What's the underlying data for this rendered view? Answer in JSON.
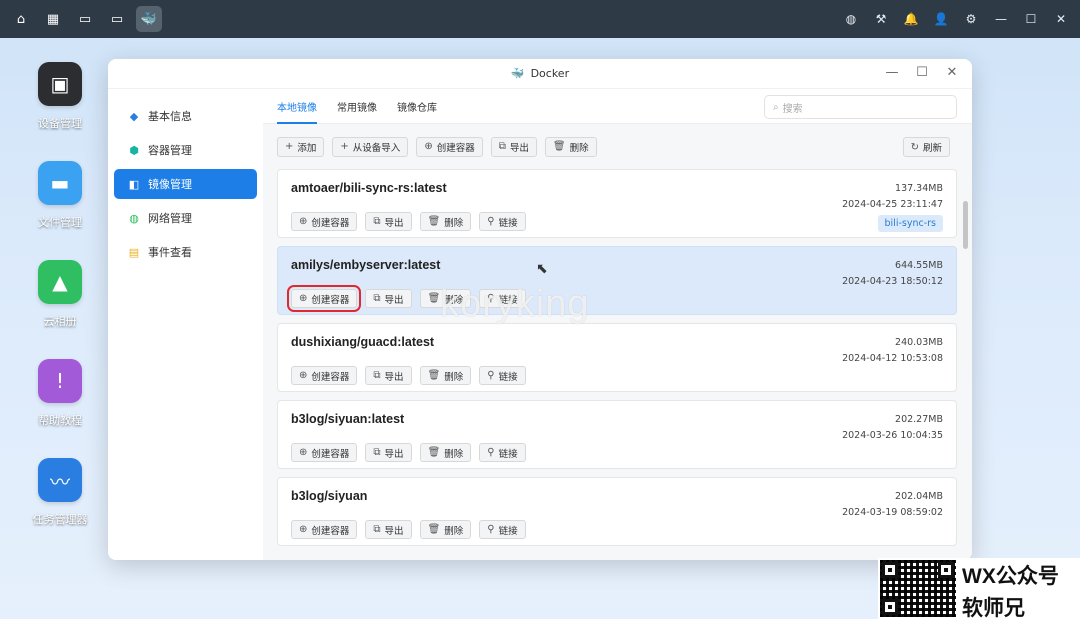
{
  "taskbar": {
    "left_icons": [
      "home-icon",
      "apps-grid-icon",
      "window-icon",
      "window-icon",
      "docker-icon"
    ],
    "right_icons": [
      "globe-icon",
      "tools-icon",
      "bell-icon",
      "user-icon",
      "settings-icon",
      "minimize-icon",
      "maximize-icon",
      "close-icon"
    ]
  },
  "desktop": {
    "items": [
      {
        "label": "设备管理",
        "icon": "device-icon",
        "color": "#2b2d31"
      },
      {
        "label": "文件管理",
        "icon": "folder-icon",
        "color": "#3aa2f0"
      },
      {
        "label": "云相册",
        "icon": "photo-icon",
        "color": "#2fbf62"
      },
      {
        "label": "帮助教程",
        "icon": "help-icon",
        "color": "#a25ad8"
      },
      {
        "label": "任务管理器",
        "icon": "monitor-icon",
        "color": "#2a7de1"
      }
    ]
  },
  "window": {
    "title": "Docker",
    "sidebar": [
      {
        "label": "基本信息",
        "icon": "docker-icon",
        "active": false
      },
      {
        "label": "容器管理",
        "icon": "cube-icon",
        "active": false
      },
      {
        "label": "镜像管理",
        "icon": "image-icon",
        "active": true
      },
      {
        "label": "网络管理",
        "icon": "globe-icon",
        "active": false
      },
      {
        "label": "事件查看",
        "icon": "event-icon",
        "active": false
      }
    ],
    "tabs": [
      "本地镜像",
      "常用镜像",
      "镜像仓库"
    ],
    "search_placeholder": "搜索",
    "toolbar": {
      "add": "添加",
      "import": "从设备导入",
      "create": "创建容器",
      "export": "导出",
      "delete": "删除",
      "refresh": "刷新"
    },
    "card_actions": {
      "create": "创建容器",
      "export": "导出",
      "delete": "删除",
      "link": "链接"
    },
    "images": [
      {
        "name": "amtoaer/bili-sync-rs:latest",
        "size": "137.34MB",
        "date": "2024-04-25 23:11:47",
        "tag": "bili-sync-rs"
      },
      {
        "name": "amilys/embyserver:latest",
        "size": "644.55MB",
        "date": "2024-04-23 18:50:12",
        "tag": ""
      },
      {
        "name": "dushixiang/guacd:latest",
        "size": "240.03MB",
        "date": "2024-04-12 10:53:08",
        "tag": ""
      },
      {
        "name": "b3log/siyuan:latest",
        "size": "202.27MB",
        "date": "2024-03-26 10:04:35",
        "tag": ""
      },
      {
        "name": "b3log/siyuan",
        "size": "202.04MB",
        "date": "2024-03-19 08:59:02",
        "tag": ""
      }
    ]
  },
  "watermark": "koryking",
  "badge": {
    "line1": "WX公众号",
    "line2": "软师兄"
  },
  "colors": {
    "accent": "#1e7ee8",
    "highlight": "#e0292e",
    "selected_row": "#dce9fa"
  }
}
